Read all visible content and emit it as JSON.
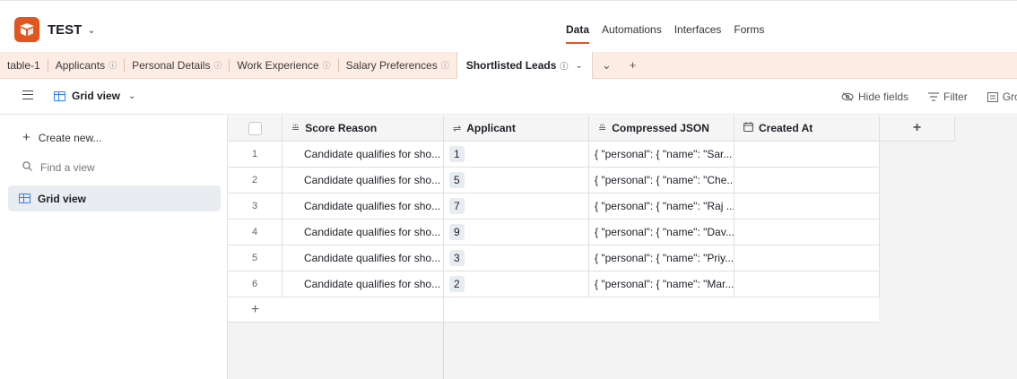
{
  "header": {
    "base_name": "TEST",
    "nav": [
      "Data",
      "Automations",
      "Interfaces",
      "Forms"
    ]
  },
  "tables": {
    "tabs": [
      {
        "label": "table-1",
        "info": false
      },
      {
        "label": "Applicants",
        "info": true
      },
      {
        "label": "Personal Details",
        "info": true
      },
      {
        "label": "Work Experience",
        "info": true
      },
      {
        "label": "Salary Preferences",
        "info": true
      }
    ],
    "selected": "Shortlisted Leads"
  },
  "viewbar": {
    "view_name": "Grid view",
    "hide_fields": "Hide fields",
    "filter": "Filter",
    "group": "Gro"
  },
  "sidebar": {
    "create_new": "Create new...",
    "find_placeholder": "Find a view",
    "views": [
      "Grid view"
    ]
  },
  "grid": {
    "columns": [
      "Score Reason",
      "Applicant",
      "Compressed JSON",
      "Created At"
    ],
    "rows": [
      {
        "num": "1",
        "score_reason": "Candidate qualifies for sho...",
        "applicant": "1",
        "json": "{ \"personal\": { \"name\": \"Sar...",
        "created_at": ""
      },
      {
        "num": "2",
        "score_reason": "Candidate qualifies for sho...",
        "applicant": "5",
        "json": "{ \"personal\": { \"name\": \"Che...",
        "created_at": ""
      },
      {
        "num": "3",
        "score_reason": "Candidate qualifies for sho...",
        "applicant": "7",
        "json": "{ \"personal\": { \"name\": \"Raj ...",
        "created_at": ""
      },
      {
        "num": "4",
        "score_reason": "Candidate qualifies for sho...",
        "applicant": "9",
        "json": "{ \"personal\": { \"name\": \"Dav...",
        "created_at": ""
      },
      {
        "num": "5",
        "score_reason": "Candidate qualifies for sho...",
        "applicant": "3",
        "json": "{ \"personal\": { \"name\": \"Priy...",
        "created_at": ""
      },
      {
        "num": "6",
        "score_reason": "Candidate qualifies for sho...",
        "applicant": "2",
        "json": "{ \"personal\": { \"name\": \"Mar...",
        "created_at": ""
      }
    ]
  },
  "colors": {
    "accent": "#e3551f",
    "tabbar_bg": "#fdece4",
    "grid_icon": "#2d7ff9"
  }
}
